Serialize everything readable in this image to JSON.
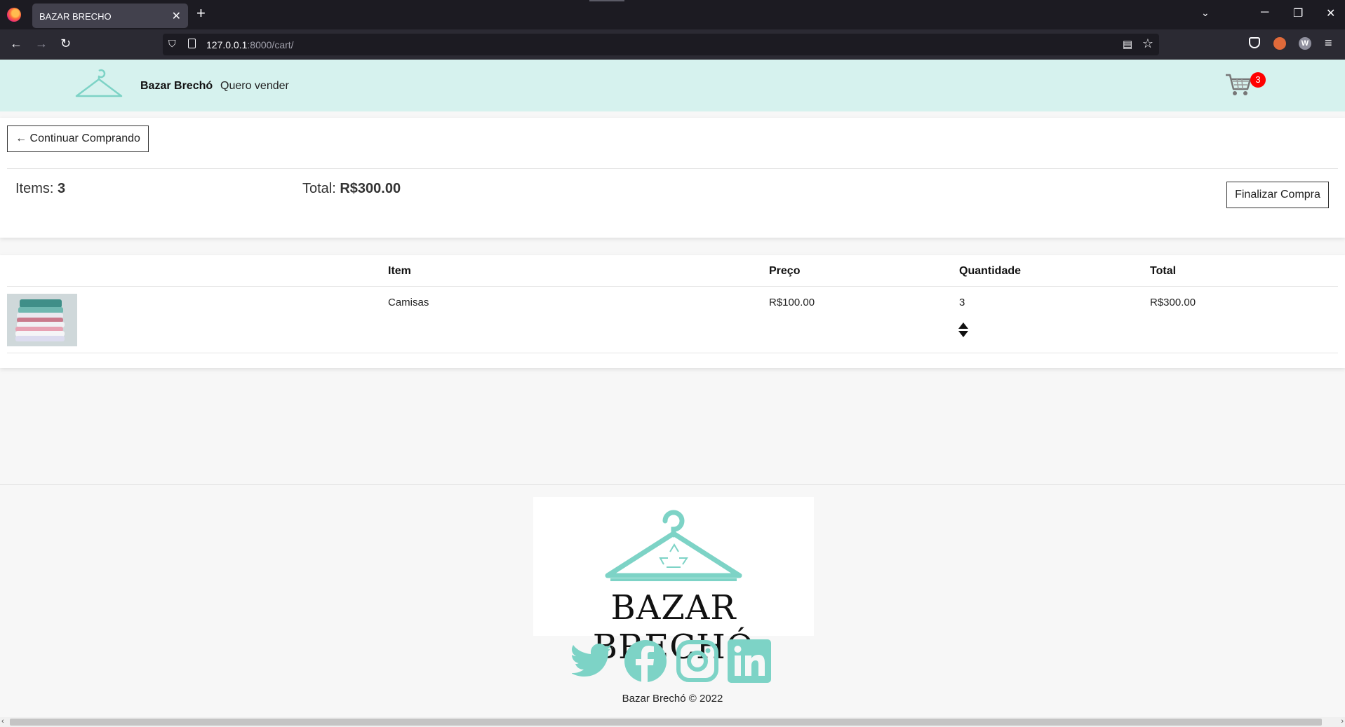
{
  "browser": {
    "tab_title": "BAZAR BRECHO",
    "url_host": "127.0.0.1",
    "url_path": ":8000/cart/"
  },
  "header": {
    "brand": "Bazar Brechó",
    "sell_link": "Quero vender",
    "cart_count": "3"
  },
  "summary": {
    "continue_label": "← Continuar Comprando",
    "items_label": "Items: ",
    "items_count": "3",
    "total_label": "Total: ",
    "total_value": "R$300.00",
    "checkout_label": "Finalizar Compra"
  },
  "table": {
    "headers": [
      "Item",
      "Preço",
      "Quantidade",
      "Total"
    ],
    "rows": [
      {
        "item": "Camisas",
        "price": "R$100.00",
        "quantity": "3",
        "total": "R$300.00"
      }
    ]
  },
  "footer": {
    "logo_text": "BAZAR BRECHÓ",
    "copyright": "Bazar Brechó © 2022",
    "socials": [
      "twitter-icon",
      "facebook-icon",
      "instagram-icon",
      "linkedin-icon"
    ]
  },
  "colors": {
    "header_bg": "#d6f2ee",
    "brand_teal": "#7dd3c6",
    "badge": "#ff0000"
  }
}
